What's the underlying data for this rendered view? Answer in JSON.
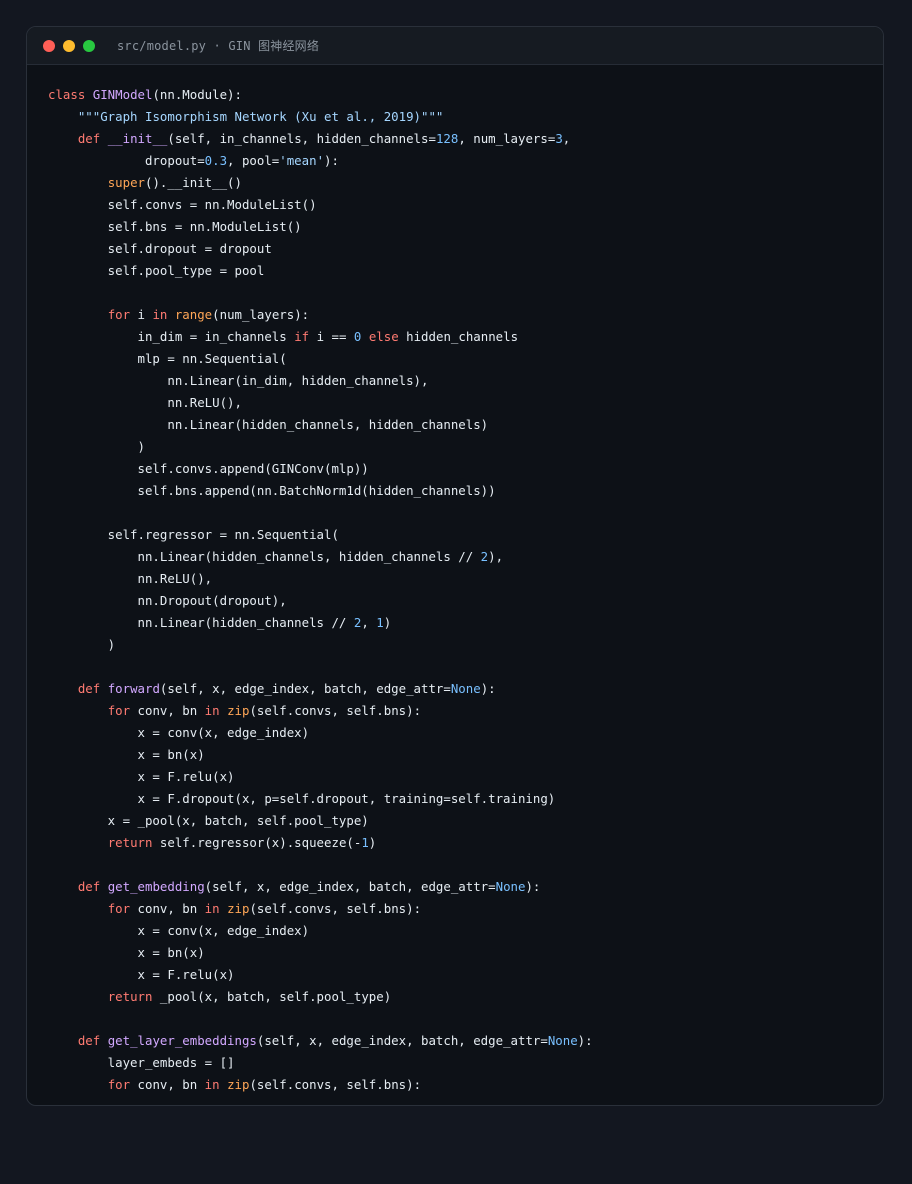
{
  "window": {
    "title": "src/model.py · GIN 图神经网络",
    "controls": [
      {
        "name": "close",
        "color": "#ff5f57"
      },
      {
        "name": "minimize",
        "color": "#febc2e"
      },
      {
        "name": "zoom",
        "color": "#28c840"
      }
    ]
  },
  "code": {
    "language": "python",
    "lines": [
      [
        {
          "t": "class ",
          "c": "kw"
        },
        {
          "t": "GINModel",
          "c": "fn"
        },
        {
          "t": "(nn.Module):",
          "c": "tx"
        }
      ],
      [
        {
          "t": "    ",
          "c": "tx"
        },
        {
          "t": "\"\"\"Graph Isomorphism Network (Xu et al., 2019)\"\"\"",
          "c": "str"
        }
      ],
      [
        {
          "t": "    ",
          "c": "tx"
        },
        {
          "t": "def ",
          "c": "kw"
        },
        {
          "t": "__init__",
          "c": "fn"
        },
        {
          "t": "(self, in_channels, hidden_channels=",
          "c": "tx"
        },
        {
          "t": "128",
          "c": "num"
        },
        {
          "t": ", num_layers=",
          "c": "tx"
        },
        {
          "t": "3",
          "c": "num"
        },
        {
          "t": ",",
          "c": "tx"
        }
      ],
      [
        {
          "t": "             dropout=",
          "c": "tx"
        },
        {
          "t": "0.3",
          "c": "num"
        },
        {
          "t": ", pool=",
          "c": "tx"
        },
        {
          "t": "'mean'",
          "c": "str"
        },
        {
          "t": "):",
          "c": "tx"
        }
      ],
      [
        {
          "t": "        ",
          "c": "tx"
        },
        {
          "t": "super",
          "c": "bi"
        },
        {
          "t": "().__init__()",
          "c": "tx"
        }
      ],
      [
        {
          "t": "        self.convs = nn.ModuleList()",
          "c": "tx"
        }
      ],
      [
        {
          "t": "        self.bns = nn.ModuleList()",
          "c": "tx"
        }
      ],
      [
        {
          "t": "        self.dropout = dropout",
          "c": "tx"
        }
      ],
      [
        {
          "t": "        self.pool_type = pool",
          "c": "tx"
        }
      ],
      [],
      [
        {
          "t": "        ",
          "c": "tx"
        },
        {
          "t": "for ",
          "c": "kw"
        },
        {
          "t": "i ",
          "c": "tx"
        },
        {
          "t": "in ",
          "c": "kw"
        },
        {
          "t": "range",
          "c": "bi"
        },
        {
          "t": "(num_layers):",
          "c": "tx"
        }
      ],
      [
        {
          "t": "            in_dim = in_channels ",
          "c": "tx"
        },
        {
          "t": "if ",
          "c": "kw"
        },
        {
          "t": "i == ",
          "c": "tx"
        },
        {
          "t": "0",
          "c": "num"
        },
        {
          "t": " ",
          "c": "tx"
        },
        {
          "t": "else ",
          "c": "kw"
        },
        {
          "t": "hidden_channels",
          "c": "tx"
        }
      ],
      [
        {
          "t": "            mlp = nn.Sequential(",
          "c": "tx"
        }
      ],
      [
        {
          "t": "                nn.Linear(in_dim, hidden_channels),",
          "c": "tx"
        }
      ],
      [
        {
          "t": "                nn.ReLU(),",
          "c": "tx"
        }
      ],
      [
        {
          "t": "                nn.Linear(hidden_channels, hidden_channels)",
          "c": "tx"
        }
      ],
      [
        {
          "t": "            )",
          "c": "tx"
        }
      ],
      [
        {
          "t": "            self.convs.append(GINConv(mlp))",
          "c": "tx"
        }
      ],
      [
        {
          "t": "            self.bns.append(nn.BatchNorm1d(hidden_channels))",
          "c": "tx"
        }
      ],
      [],
      [
        {
          "t": "        self.regressor = nn.Sequential(",
          "c": "tx"
        }
      ],
      [
        {
          "t": "            nn.Linear(hidden_channels, hidden_channels // ",
          "c": "tx"
        },
        {
          "t": "2",
          "c": "num"
        },
        {
          "t": "),",
          "c": "tx"
        }
      ],
      [
        {
          "t": "            nn.ReLU(),",
          "c": "tx"
        }
      ],
      [
        {
          "t": "            nn.Dropout(dropout),",
          "c": "tx"
        }
      ],
      [
        {
          "t": "            nn.Linear(hidden_channels // ",
          "c": "tx"
        },
        {
          "t": "2",
          "c": "num"
        },
        {
          "t": ", ",
          "c": "tx"
        },
        {
          "t": "1",
          "c": "num"
        },
        {
          "t": ")",
          "c": "tx"
        }
      ],
      [
        {
          "t": "        )",
          "c": "tx"
        }
      ],
      [],
      [
        {
          "t": "    ",
          "c": "tx"
        },
        {
          "t": "def ",
          "c": "kw"
        },
        {
          "t": "forward",
          "c": "fn"
        },
        {
          "t": "(self, x, edge_index, batch, edge_attr=",
          "c": "tx"
        },
        {
          "t": "None",
          "c": "num"
        },
        {
          "t": "):",
          "c": "tx"
        }
      ],
      [
        {
          "t": "        ",
          "c": "tx"
        },
        {
          "t": "for ",
          "c": "kw"
        },
        {
          "t": "conv, bn ",
          "c": "tx"
        },
        {
          "t": "in ",
          "c": "kw"
        },
        {
          "t": "zip",
          "c": "bi"
        },
        {
          "t": "(self.convs, self.bns):",
          "c": "tx"
        }
      ],
      [
        {
          "t": "            x = conv(x, edge_index)",
          "c": "tx"
        }
      ],
      [
        {
          "t": "            x = bn(x)",
          "c": "tx"
        }
      ],
      [
        {
          "t": "            x = F.relu(x)",
          "c": "tx"
        }
      ],
      [
        {
          "t": "            x = F.dropout(x, p=self.dropout, training=self.training)",
          "c": "tx"
        }
      ],
      [
        {
          "t": "        x = _pool(x, batch, self.pool_type)",
          "c": "tx"
        }
      ],
      [
        {
          "t": "        ",
          "c": "tx"
        },
        {
          "t": "return ",
          "c": "kw"
        },
        {
          "t": "self.regressor(x).squeeze(-",
          "c": "tx"
        },
        {
          "t": "1",
          "c": "num"
        },
        {
          "t": ")",
          "c": "tx"
        }
      ],
      [],
      [
        {
          "t": "    ",
          "c": "tx"
        },
        {
          "t": "def ",
          "c": "kw"
        },
        {
          "t": "get_embedding",
          "c": "fn"
        },
        {
          "t": "(self, x, edge_index, batch, edge_attr=",
          "c": "tx"
        },
        {
          "t": "None",
          "c": "num"
        },
        {
          "t": "):",
          "c": "tx"
        }
      ],
      [
        {
          "t": "        ",
          "c": "tx"
        },
        {
          "t": "for ",
          "c": "kw"
        },
        {
          "t": "conv, bn ",
          "c": "tx"
        },
        {
          "t": "in ",
          "c": "kw"
        },
        {
          "t": "zip",
          "c": "bi"
        },
        {
          "t": "(self.convs, self.bns):",
          "c": "tx"
        }
      ],
      [
        {
          "t": "            x = conv(x, edge_index)",
          "c": "tx"
        }
      ],
      [
        {
          "t": "            x = bn(x)",
          "c": "tx"
        }
      ],
      [
        {
          "t": "            x = F.relu(x)",
          "c": "tx"
        }
      ],
      [
        {
          "t": "        ",
          "c": "tx"
        },
        {
          "t": "return ",
          "c": "kw"
        },
        {
          "t": "_pool(x, batch, self.pool_type)",
          "c": "tx"
        }
      ],
      [],
      [
        {
          "t": "    ",
          "c": "tx"
        },
        {
          "t": "def ",
          "c": "kw"
        },
        {
          "t": "get_layer_embeddings",
          "c": "fn"
        },
        {
          "t": "(self, x, edge_index, batch, edge_attr=",
          "c": "tx"
        },
        {
          "t": "None",
          "c": "num"
        },
        {
          "t": "):",
          "c": "tx"
        }
      ],
      [
        {
          "t": "        layer_embeds = []",
          "c": "tx"
        }
      ],
      [
        {
          "t": "        ",
          "c": "tx"
        },
        {
          "t": "for ",
          "c": "kw"
        },
        {
          "t": "conv, bn ",
          "c": "tx"
        },
        {
          "t": "in ",
          "c": "kw"
        },
        {
          "t": "zip",
          "c": "bi"
        },
        {
          "t": "(self.convs, self.bns):",
          "c": "tx"
        }
      ]
    ]
  }
}
